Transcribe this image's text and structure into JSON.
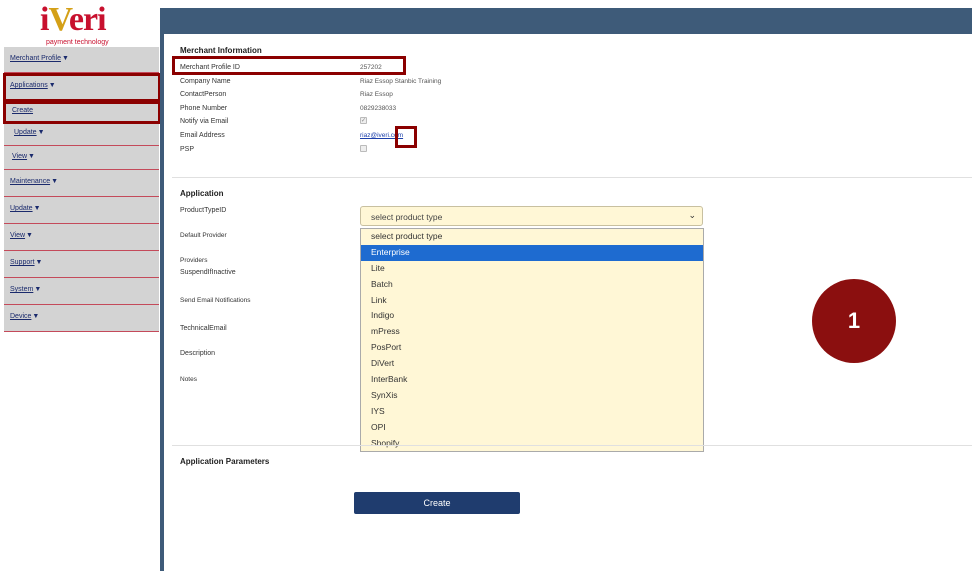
{
  "brand": {
    "name_pre": "i",
    "name_v": "V",
    "name_post": "eri",
    "tagline": "payment technology"
  },
  "sidebar": {
    "items": [
      {
        "label": "Merchant Profile"
      },
      {
        "label": "Applications"
      },
      {
        "label": "Create"
      },
      {
        "label": "Update"
      },
      {
        "label": "View"
      },
      {
        "label": "Maintenance"
      },
      {
        "label": "Update"
      },
      {
        "label": "View"
      },
      {
        "label": "Support"
      },
      {
        "label": "System"
      },
      {
        "label": "Device"
      }
    ]
  },
  "merchant": {
    "title": "Merchant Information",
    "rows": [
      {
        "label": "Merchant Profile ID",
        "value": "257202"
      },
      {
        "label": "Company Name",
        "value": "Riaz Essop Stanbic Training"
      },
      {
        "label": "ContactPerson",
        "value": "Riaz Essop"
      },
      {
        "label": "Phone Number",
        "value": "0829238033"
      },
      {
        "label": "Notify via Email",
        "checked": true
      },
      {
        "label": "Email Address",
        "value": "riaz@iveri.com"
      },
      {
        "label": "PSP",
        "checked": false
      }
    ]
  },
  "application": {
    "title": "Application",
    "fields": [
      "ProductTypeID",
      "Default Provider",
      "Providers",
      "SuspendIfInactive",
      "Send Email Notifications",
      "TechnicalEmail",
      "Description",
      "Notes"
    ],
    "select": {
      "value": "select product type",
      "options": [
        "select product type",
        "Enterprise",
        "Lite",
        "Batch",
        "Link",
        "Indigo",
        "mPress",
        "PosPort",
        "DiVert",
        "InterBank",
        "SynXis",
        "IYS",
        "OPI",
        "Shopify"
      ],
      "selected_index": 1
    }
  },
  "params": {
    "title": "Application Parameters"
  },
  "create_label": "Create",
  "step_badge": "1",
  "colors": {
    "accent": "#8b0000",
    "header": "#3e5b79",
    "button": "#1f3c6e",
    "selected": "#1e6bd0"
  }
}
